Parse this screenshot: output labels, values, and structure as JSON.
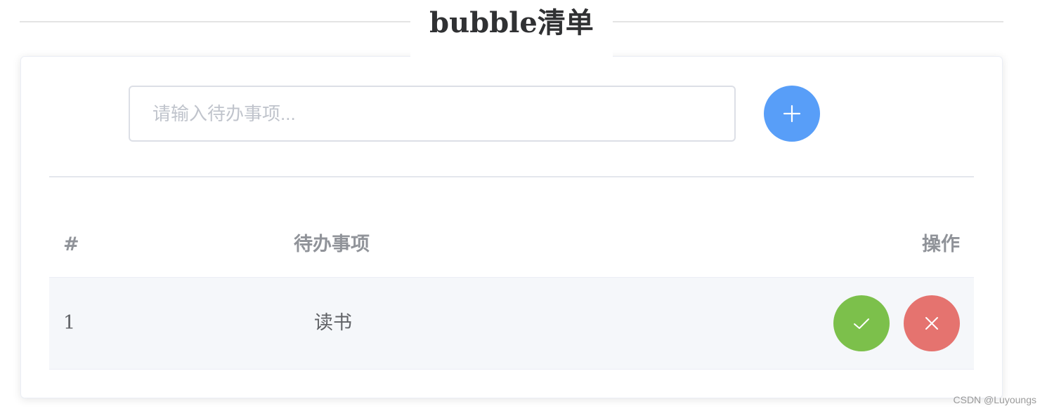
{
  "page": {
    "title": "bubble清单",
    "watermark": "CSDN @Luyoungs"
  },
  "todo_input": {
    "value": "",
    "placeholder": "请输入待办事项..."
  },
  "add_button": {
    "icon": "plus-icon",
    "color": "#589ef8"
  },
  "table": {
    "headers": [
      "#",
      "待办事项",
      "操作"
    ],
    "rows": [
      {
        "index": "1",
        "item": "读书",
        "actions": [
          {
            "name": "complete",
            "icon": "check-icon",
            "color": "#7cc04b"
          },
          {
            "name": "delete",
            "icon": "close-icon",
            "color": "#e5736f"
          }
        ]
      }
    ]
  }
}
